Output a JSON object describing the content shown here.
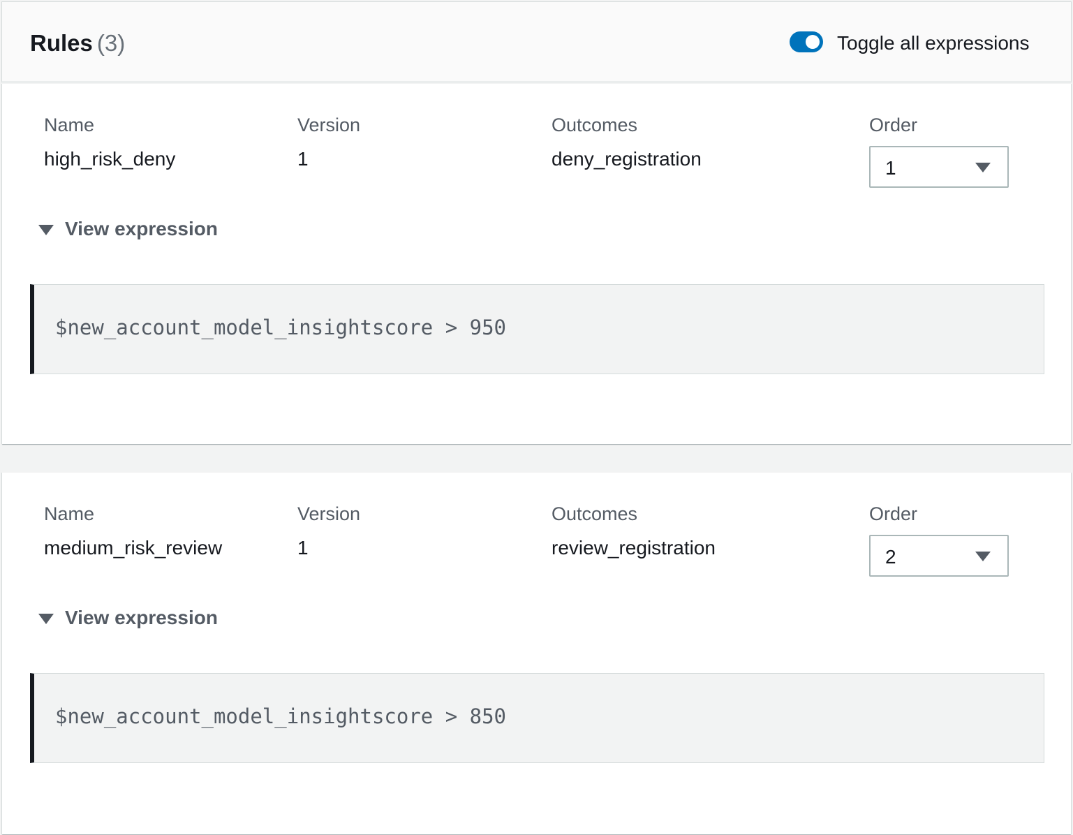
{
  "header": {
    "title": "Rules",
    "count": "(3)",
    "toggle_label": "Toggle all expressions",
    "toggle_on": true
  },
  "columns": {
    "name": "Name",
    "version": "Version",
    "outcomes": "Outcomes",
    "order": "Order"
  },
  "rules": [
    {
      "name": "high_risk_deny",
      "version": "1",
      "outcomes": "deny_registration",
      "order": "1",
      "expander_label": "View expression",
      "expression": "$new_account_model_insightscore > 950"
    },
    {
      "name": "medium_risk_review",
      "version": "1",
      "outcomes": "review_registration",
      "order": "2",
      "expander_label": "View expression",
      "expression": "$new_account_model_insightscore > 850"
    }
  ],
  "colors": {
    "toggle_accent": "#0073bb",
    "text_primary": "#16191f",
    "text_secondary": "#545b64"
  }
}
